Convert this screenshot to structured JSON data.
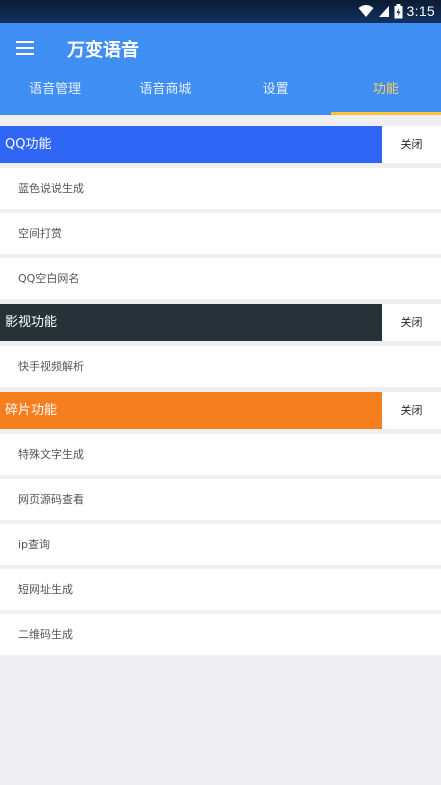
{
  "status_bar": {
    "time": "3:15",
    "icons": [
      "wifi-icon",
      "signal-icon",
      "battery-icon"
    ]
  },
  "app": {
    "title": "万变语音"
  },
  "tabs": [
    {
      "label": "语音管理",
      "active": false
    },
    {
      "label": "语音商城",
      "active": false
    },
    {
      "label": "设置",
      "active": false
    },
    {
      "label": "功能",
      "active": true
    }
  ],
  "sections": [
    {
      "title": "QQ功能",
      "color": "#2f66f6",
      "close_label": "关闭",
      "items": [
        "蓝色说说生成",
        "空间打赏",
        "QQ空白网名"
      ]
    },
    {
      "title": "影视功能",
      "color": "#263238",
      "close_label": "关闭",
      "items": [
        "快手视频解析"
      ]
    },
    {
      "title": "碎片功能",
      "color": "#f57f1f",
      "close_label": "关闭",
      "items": [
        "特殊文字生成",
        "网页源码查看",
        "ip查询",
        "短网址生成",
        "二维码生成"
      ]
    }
  ],
  "colors": {
    "app_bar": "#3f8ef3",
    "active_tab": "#ffc233",
    "background": "#efeff2"
  }
}
